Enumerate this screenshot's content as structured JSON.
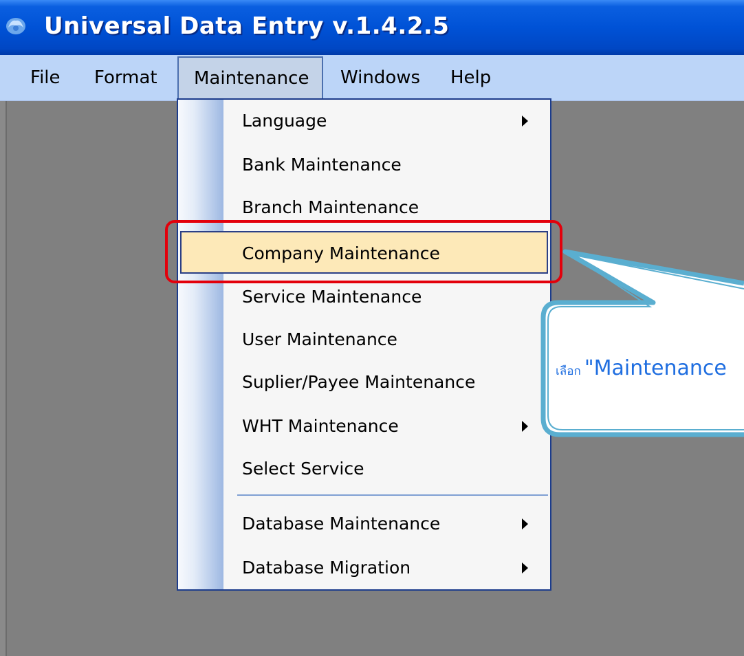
{
  "window": {
    "title": "Universal Data Entry v.1.4.2.5",
    "icon": "app-logo-icon"
  },
  "menubar": {
    "items": [
      {
        "label": "File"
      },
      {
        "label": "Format"
      },
      {
        "label": "Maintenance",
        "open": true
      },
      {
        "label": "Windows"
      },
      {
        "label": "Help"
      }
    ]
  },
  "dropdown": {
    "items": [
      {
        "label": "Language",
        "submenu": true
      },
      {
        "label": "Bank Maintenance"
      },
      {
        "label": "Branch Maintenance"
      },
      {
        "label": "Company Maintenance",
        "highlighted": true
      },
      {
        "label": "Service Maintenance"
      },
      {
        "label": "User Maintenance"
      },
      {
        "label": "Suplier/Payee Maintenance"
      },
      {
        "label": "WHT Maintenance",
        "submenu": true
      },
      {
        "label": "Select Service"
      },
      {
        "label": "Database Maintenance",
        "submenu": true
      },
      {
        "label": "Database Migration",
        "submenu": true
      }
    ]
  },
  "callout": {
    "prefix": "เลือก",
    "text": "\"Maintenance"
  },
  "colors": {
    "highlight_box": "#e3000b",
    "callout_border": "#5aaed0",
    "callout_text": "#1f6ee0",
    "selected_item_bg": "#fde9b8"
  }
}
